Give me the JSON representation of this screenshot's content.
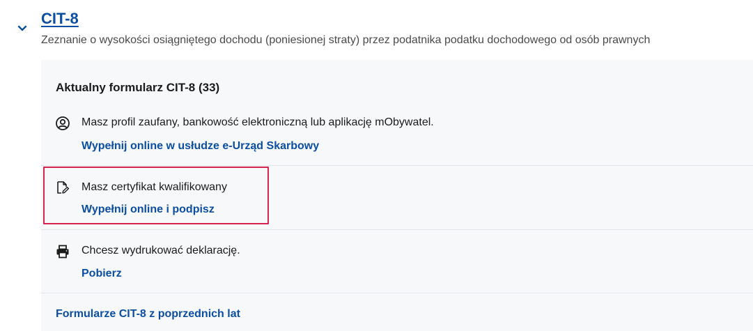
{
  "form": {
    "title": "CIT-8",
    "description": "Zeznanie o wysokości osiągniętego dochodu (poniesionej straty) przez podatnika podatku dochodowego od osób prawnych"
  },
  "panel": {
    "heading": "Aktualny formularz CIT-8 (33)",
    "options": [
      {
        "icon": "user-profile-icon",
        "text": "Masz profil zaufany, bankowość elektroniczną lub aplikację mObywatel.",
        "link": "Wypełnij online w usłudze e-Urząd Skarbowy"
      },
      {
        "icon": "document-edit-icon",
        "text": "Masz certyfikat kwalifikowany",
        "link": "Wypełnij online i podpisz"
      },
      {
        "icon": "printer-icon",
        "text": "Chcesz wydrukować deklarację.",
        "link": "Pobierz"
      }
    ],
    "history_link": "Formularze CIT-8 z poprzednich lat"
  },
  "colors": {
    "link": "#0b4ea2",
    "highlight": "#d6234f",
    "panel_bg": "#f7f8fa"
  }
}
